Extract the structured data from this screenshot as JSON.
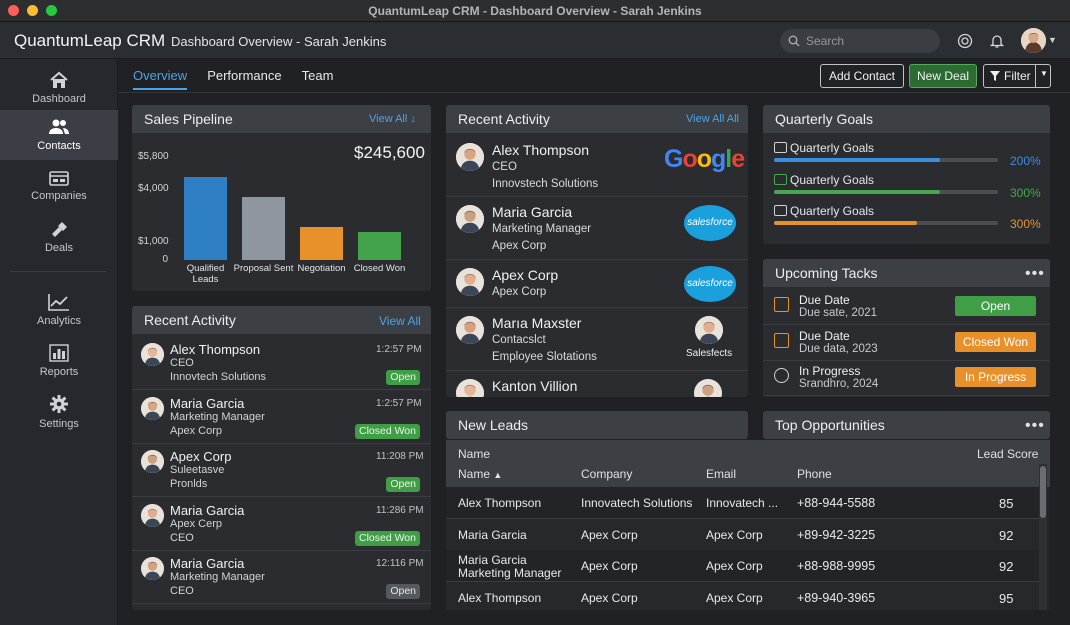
{
  "window": {
    "title": "QuantumLeap CRM - Dashboard Overview - Sarah Jenkins"
  },
  "header": {
    "brand": "QuantumLeap CRM",
    "breadcrumb": "Dashboard Overview - Sarah Jenkins",
    "search_placeholder": "Search"
  },
  "sidebar": {
    "items": [
      {
        "label": "Dashboard",
        "icon": "home-icon"
      },
      {
        "label": "Contacts",
        "icon": "users-icon",
        "active": true
      },
      {
        "label": "Companies",
        "icon": "building-icon"
      },
      {
        "label": "Deals",
        "icon": "handshake-icon"
      },
      {
        "label": "Analytics",
        "icon": "line-chart-icon"
      },
      {
        "label": "Reports",
        "icon": "bar-chart-icon"
      },
      {
        "label": "Settings",
        "icon": "gear-icon"
      }
    ]
  },
  "tabs": [
    {
      "label": "Overview",
      "active": true
    },
    {
      "label": "Performance"
    },
    {
      "label": "Team"
    }
  ],
  "toolbar": {
    "add_contact": "Add Contact",
    "new_deal": "New Deal",
    "filter": "Filter"
  },
  "pipeline": {
    "title": "Sales Pipeline",
    "view_all": "View All",
    "total": "$245,600",
    "chart_data": {
      "type": "bar",
      "categories": [
        "Qualified Leads",
        "Proposal Sent",
        "Negotiation",
        "Closed Won"
      ],
      "values": [
        4700,
        3550,
        1850,
        1550
      ],
      "colors": [
        "#2f7fc4",
        "#8f969e",
        "#e8912b",
        "#43a34a"
      ],
      "ytick_labels": [
        "$5,800",
        "$4,000",
        "$1,000",
        "0"
      ],
      "ytick_values": [
        5800,
        4000,
        1000,
        0
      ],
      "xtick_labels": [
        "Qualified Leads",
        "Proposal Sent",
        "Negotiation",
        "Closed Won"
      ],
      "ylim": [
        0,
        5800
      ]
    }
  },
  "recent_activity_left": {
    "title": "Recent Activity",
    "view_all": "View All",
    "items": [
      {
        "name": "Alex Thompson",
        "line2": "CEO",
        "line3": "Innovtech Solutions",
        "time": "1:2:57 PM",
        "status": "Open",
        "status_color": "green"
      },
      {
        "name": "Maria Garcia",
        "line2": "Marketing Manager",
        "line3": "Apex Corp",
        "time": "1:2:57 PM",
        "status": "Closed Won",
        "status_color": "green"
      },
      {
        "name": "Apex Corp",
        "line2": "Suleetasve",
        "line3": "Pronlds",
        "time": "11:208 PM",
        "status": "Open",
        "status_color": "green"
      },
      {
        "name": "Maria Garcia",
        "line2": "Apex Cerp",
        "line3": "CEO",
        "time": "11:286 PM",
        "status": "Closed Won",
        "status_color": "green"
      },
      {
        "name": "Maria Garcia",
        "line2": "Marketing Manager",
        "line3": "CEO",
        "time": "12:116 PM",
        "status": "Open",
        "status_color": "grey"
      }
    ]
  },
  "recent_activity_mid": {
    "title": "Recent Activity",
    "view_all": "View All All",
    "items": [
      {
        "name": "Alex Thompson",
        "line2": "CEO",
        "line3": "Innovstech Solutions",
        "logo": "Google"
      },
      {
        "name": "Maria Garcia",
        "line2": "Marketing Manager",
        "line3": "Apex Corp",
        "logo": "salesforce"
      },
      {
        "name": "Apex Corp",
        "line2": "Apex Corp",
        "line3": "",
        "logo": "salesforce"
      },
      {
        "name": "Marıa Maxster",
        "line2": "Contacslct",
        "line3": "Employee Slotations",
        "logo": "Salesfects"
      },
      {
        "name": "Kanton Villion",
        "line2": "",
        "line3": "",
        "logo": ""
      }
    ]
  },
  "quarterly_goals": {
    "title": "Quarterly Goals",
    "items": [
      {
        "label": "Quarterly Goals",
        "pct": "200%",
        "fill": 0.74,
        "color": "#3d8de0",
        "icon": "trend-icon"
      },
      {
        "label": "Quarterly Goals",
        "pct": "300%",
        "fill": 0.74,
        "color": "#45a84b",
        "icon": "money-icon"
      },
      {
        "label": "Quarterly Goals",
        "pct": "300%",
        "fill": 0.64,
        "color": "#e8912b",
        "icon": "chart-icon"
      }
    ]
  },
  "upcoming_tasks": {
    "title": "Upcoming Tacks",
    "items": [
      {
        "title": "Due Date",
        "sub": "Due sate, 2021",
        "status": "Open",
        "color": "#3f9e46",
        "icon": "calendar-icon"
      },
      {
        "title": "Due Date",
        "sub": "Due data, 2023",
        "status": "Closed Won",
        "color": "#e8912b",
        "icon": "calendar-icon"
      },
      {
        "title": "In Progress",
        "sub": "Srandhro, 2024",
        "status": "In Progress",
        "color": "#e8912b",
        "icon": "clock-icon"
      }
    ]
  },
  "new_leads": {
    "title": "New Leads"
  },
  "top_opportunities": {
    "title": "Top Opportunities",
    "head_name": "Name",
    "head_lead_score": "Lead Score",
    "columns": [
      "Name",
      "Company",
      "Email",
      "Phone"
    ],
    "rows": [
      {
        "name": "Alex Thompson",
        "name2": "",
        "company": "Innovatech Solutions",
        "email": "Innovatech ...",
        "phone": "+88-944-5588",
        "score": "85"
      },
      {
        "name": "Maria Garcia",
        "name2": "",
        "company": "Apex Corp",
        "email": "Apex Corp",
        "phone": "+89-942-3225",
        "score": "92"
      },
      {
        "name": "Maria Garcia",
        "name2": "Marketing Manager",
        "company": "Apex Corp",
        "email": "Apex Corp",
        "phone": "+88-988-9995",
        "score": "92"
      },
      {
        "name": "Alex Thompson",
        "name2": "",
        "company": "Apex Corp",
        "email": "Apex Corp",
        "phone": "+89-940-3965",
        "score": "95"
      }
    ]
  }
}
